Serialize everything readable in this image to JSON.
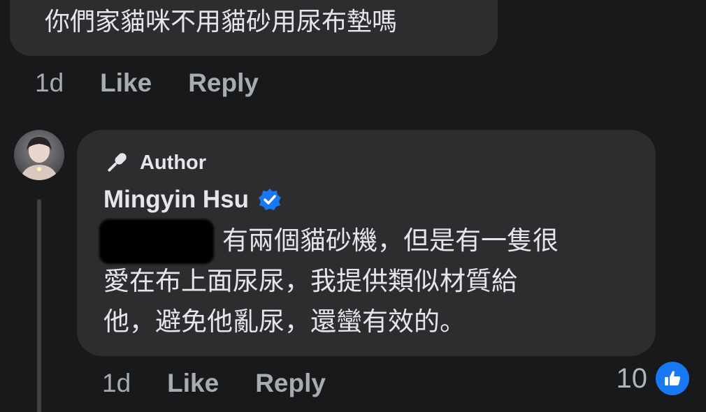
{
  "parent_comment": {
    "text": "你們家貓咪不用貓砂用尿布墊嗎",
    "time": "1d",
    "like_label": "Like",
    "reply_label": "Reply"
  },
  "reply": {
    "badge": "Author",
    "author_name": "Mingyin Hsu",
    "text_lines": [
      "有兩個貓砂機，但是有一隻很",
      "愛在布上面尿尿，我提供類似材質給",
      "他，避免他亂尿，還蠻有效的。"
    ],
    "time": "1d",
    "like_label": "Like",
    "reply_label": "Reply",
    "reaction_count": "10"
  },
  "icons": {
    "author": "microphone-icon",
    "verified": "verified-badge-icon",
    "reaction": "thumbs-up-icon"
  },
  "colors": {
    "background": "#18191a",
    "bubble": "#2d2d2f",
    "accent": "#1877f2"
  }
}
